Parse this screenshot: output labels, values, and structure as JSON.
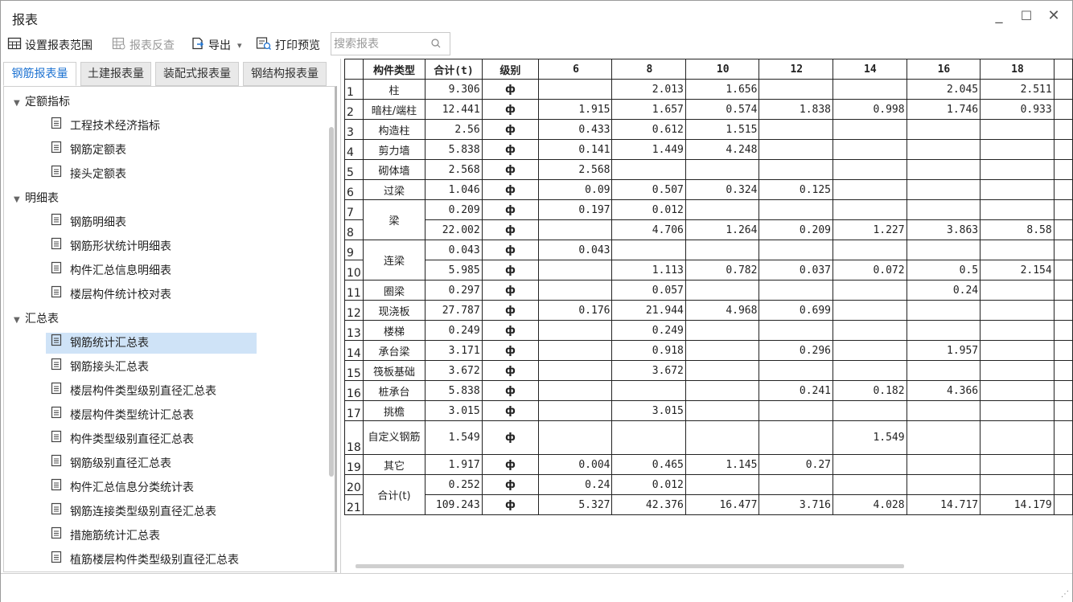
{
  "window": {
    "title": "报表",
    "minimize": "_",
    "maximize": "☐",
    "close": "✕"
  },
  "toolbar": {
    "set_range": "设置报表范围",
    "reverse_check": "报表反查",
    "export": "导出",
    "export_arrow": "▾",
    "print_preview": "打印预览",
    "search_placeholder": "搜索报表"
  },
  "tabs": [
    "钢筋报表量",
    "土建报表量",
    "装配式报表量",
    "钢结构报表量"
  ],
  "tree": {
    "group1": {
      "label": "定额指标",
      "items": [
        "工程技术经济指标",
        "钢筋定额表",
        "接头定额表"
      ]
    },
    "group2": {
      "label": "明细表",
      "items": [
        "钢筋明细表",
        "钢筋形状统计明细表",
        "构件汇总信息明细表",
        "楼层构件统计校对表"
      ]
    },
    "group3": {
      "label": "汇总表",
      "items": [
        "钢筋统计汇总表",
        "钢筋接头汇总表",
        "楼层构件类型级别直径汇总表",
        "楼层构件类型统计汇总表",
        "构件类型级别直径汇总表",
        "钢筋级别直径汇总表",
        "构件汇总信息分类统计表",
        "钢筋连接类型级别直径汇总表",
        "措施筋统计汇总表",
        "植筋楼层构件类型级别直径汇总表"
      ]
    }
  },
  "grid": {
    "headers": [
      "构件类型",
      "合计(t)",
      "级别",
      "6",
      "8",
      "10",
      "12",
      "14",
      "16",
      "18"
    ],
    "rows": [
      {
        "n": "1",
        "type": "柱",
        "total": "9.306",
        "grade": "ф",
        "v": [
          "",
          "2.013",
          "1.656",
          "",
          "",
          "2.045",
          "2.511"
        ]
      },
      {
        "n": "2",
        "type": "暗柱/端柱",
        "total": "12.441",
        "grade": "ф",
        "v": [
          "1.915",
          "1.657",
          "0.574",
          "1.838",
          "0.998",
          "1.746",
          "0.933"
        ]
      },
      {
        "n": "3",
        "type": "构造柱",
        "total": "2.56",
        "grade": "ф",
        "v": [
          "0.433",
          "0.612",
          "1.515",
          "",
          "",
          "",
          ""
        ]
      },
      {
        "n": "4",
        "type": "剪力墙",
        "total": "5.838",
        "grade": "ф",
        "v": [
          "0.141",
          "1.449",
          "4.248",
          "",
          "",
          "",
          ""
        ]
      },
      {
        "n": "5",
        "type": "砌体墙",
        "total": "2.568",
        "grade": "ф",
        "v": [
          "2.568",
          "",
          "",
          "",
          "",
          "",
          ""
        ]
      },
      {
        "n": "6",
        "type": "过梁",
        "total": "1.046",
        "grade": "ф",
        "v": [
          "0.09",
          "0.507",
          "0.324",
          "0.125",
          "",
          "",
          ""
        ]
      },
      {
        "n": "7",
        "type": "梁",
        "total": "0.209",
        "grade": "ф",
        "v": [
          "0.197",
          "0.012",
          "",
          "",
          "",
          "",
          ""
        ]
      },
      {
        "n": "8",
        "type": "",
        "total": "22.002",
        "grade": "ф",
        "v": [
          "",
          "4.706",
          "1.264",
          "0.209",
          "1.227",
          "3.863",
          "8.58"
        ]
      },
      {
        "n": "9",
        "type": "连梁",
        "total": "0.043",
        "grade": "ф",
        "v": [
          "0.043",
          "",
          "",
          "",
          "",
          "",
          ""
        ]
      },
      {
        "n": "10",
        "type": "",
        "total": "5.985",
        "grade": "ф",
        "v": [
          "",
          "1.113",
          "0.782",
          "0.037",
          "0.072",
          "0.5",
          "2.154"
        ]
      },
      {
        "n": "11",
        "type": "圈梁",
        "total": "0.297",
        "grade": "ф",
        "v": [
          "",
          "0.057",
          "",
          "",
          "",
          "0.24",
          ""
        ]
      },
      {
        "n": "12",
        "type": "现浇板",
        "total": "27.787",
        "grade": "ф",
        "v": [
          "0.176",
          "21.944",
          "4.968",
          "0.699",
          "",
          "",
          ""
        ]
      },
      {
        "n": "13",
        "type": "楼梯",
        "total": "0.249",
        "grade": "ф",
        "v": [
          "",
          "0.249",
          "",
          "",
          "",
          "",
          ""
        ]
      },
      {
        "n": "14",
        "type": "承台梁",
        "total": "3.171",
        "grade": "ф",
        "v": [
          "",
          "0.918",
          "",
          "0.296",
          "",
          "1.957",
          ""
        ]
      },
      {
        "n": "15",
        "type": "筏板基础",
        "total": "3.672",
        "grade": "ф",
        "v": [
          "",
          "3.672",
          "",
          "",
          "",
          "",
          ""
        ]
      },
      {
        "n": "16",
        "type": "桩承台",
        "total": "5.838",
        "grade": "ф",
        "v": [
          "",
          "",
          "",
          "0.241",
          "0.182",
          "4.366",
          ""
        ]
      },
      {
        "n": "17",
        "type": "挑檐",
        "total": "3.015",
        "grade": "ф",
        "v": [
          "",
          "3.015",
          "",
          "",
          "",
          "",
          ""
        ]
      },
      {
        "n": "18",
        "type": "自定义钢筋",
        "total": "1.549",
        "grade": "ф",
        "v": [
          "",
          "",
          "",
          "",
          "1.549",
          "",
          ""
        ]
      },
      {
        "n": "19",
        "type": "其它",
        "total": "1.917",
        "grade": "ф",
        "v": [
          "0.004",
          "0.465",
          "1.145",
          "0.27",
          "",
          "",
          ""
        ]
      },
      {
        "n": "20",
        "type": "合计(t)",
        "total": "0.252",
        "grade": "ф",
        "v": [
          "0.24",
          "0.012",
          "",
          "",
          "",
          "",
          ""
        ]
      },
      {
        "n": "21",
        "type": "",
        "total": "109.243",
        "grade": "ф",
        "v": [
          "5.327",
          "42.376",
          "16.477",
          "3.716",
          "4.028",
          "14.717",
          "14.179"
        ]
      }
    ]
  }
}
